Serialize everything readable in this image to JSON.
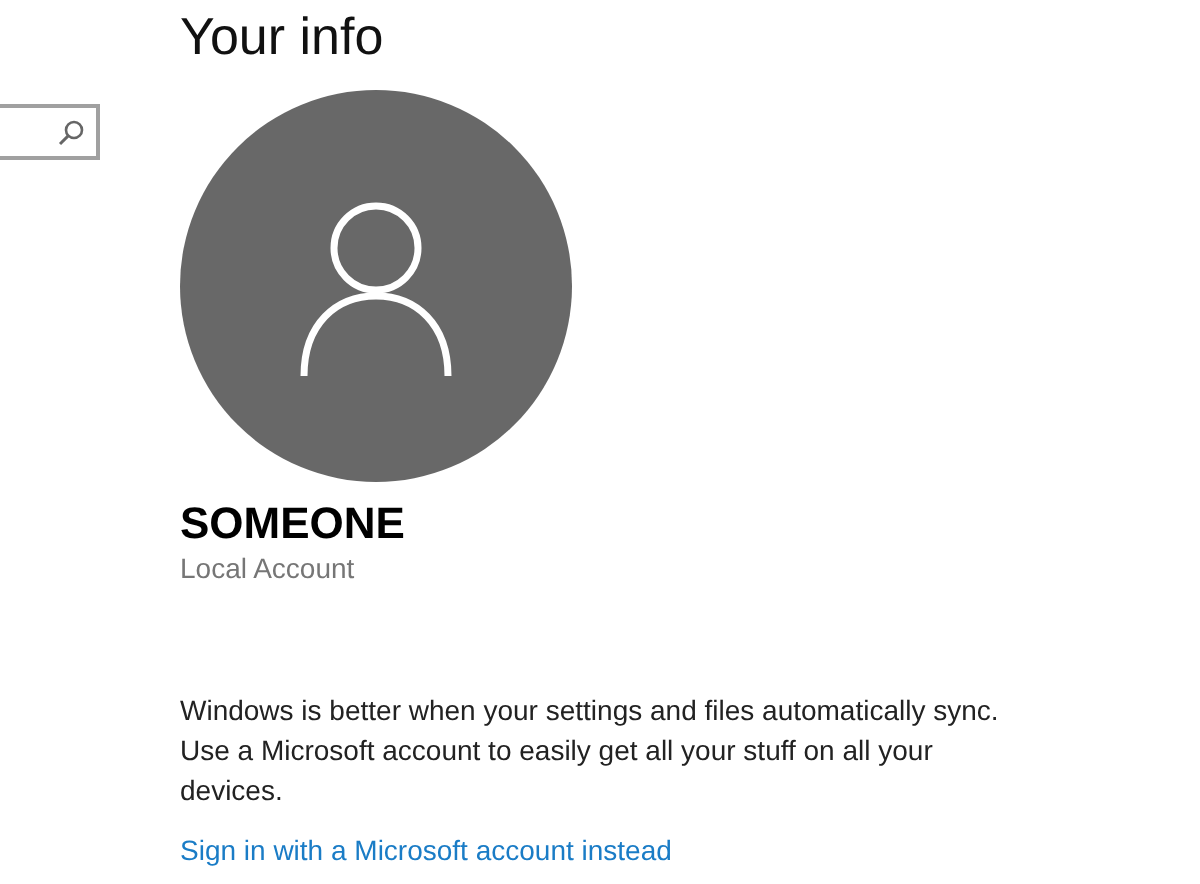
{
  "page_title": "Your info",
  "account": {
    "name": "SOMEONE",
    "type": "Local Account"
  },
  "sync_message": "Windows is better when your settings and files automatically sync. Use a Microsoft account to easily get all your stuff on all your devices.",
  "sign_in_link": "Sign in with a Microsoft account instead"
}
